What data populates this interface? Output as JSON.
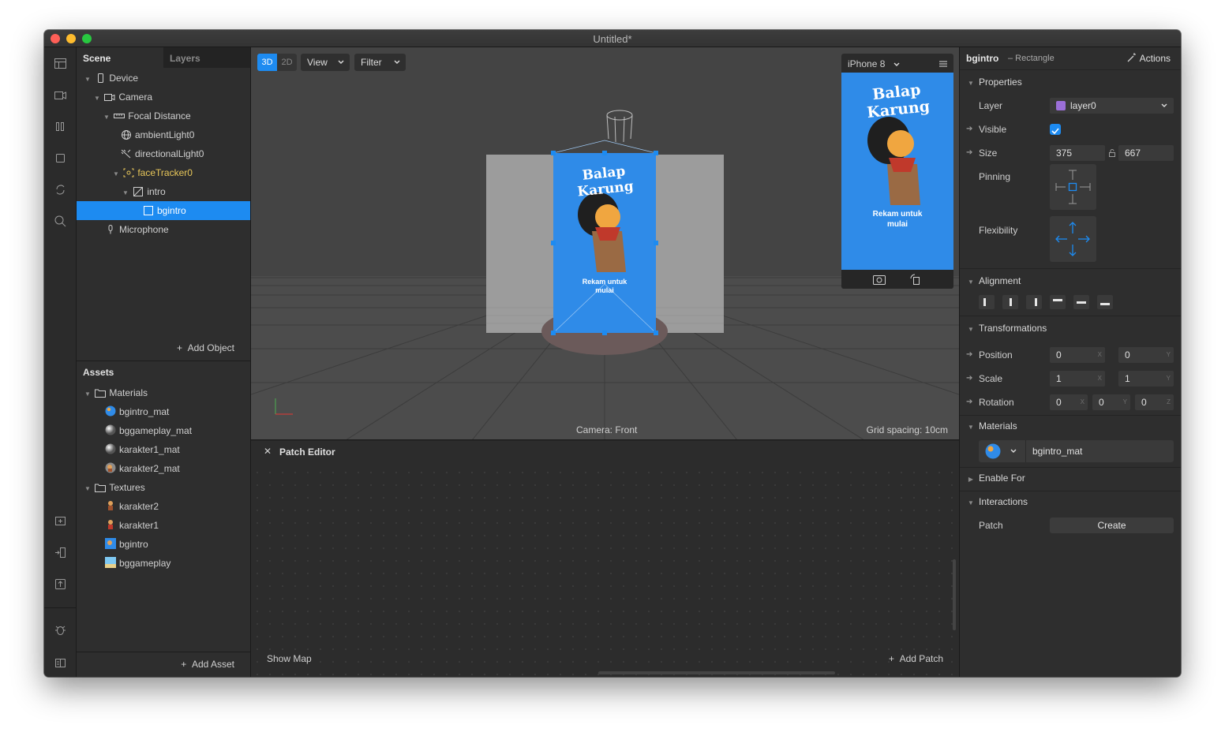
{
  "window": {
    "title": "Untitled*"
  },
  "scene_panel": {
    "tabs": [
      {
        "label": "Scene"
      },
      {
        "label": "Layers"
      }
    ],
    "tree": [
      {
        "label": "Device"
      },
      {
        "label": "Camera"
      },
      {
        "label": "Focal Distance"
      },
      {
        "label": "ambientLight0"
      },
      {
        "label": "directionalLight0"
      },
      {
        "label": "faceTracker0"
      },
      {
        "label": "intro"
      },
      {
        "label": "bgintro"
      },
      {
        "label": "Microphone"
      }
    ],
    "add_object_label": "Add Object",
    "assets_title": "Assets",
    "assets": [
      {
        "label": "Materials"
      },
      {
        "label": "bgintro_mat"
      },
      {
        "label": "bggameplay_mat"
      },
      {
        "label": "karakter1_mat"
      },
      {
        "label": "karakter2_mat"
      },
      {
        "label": "Textures"
      },
      {
        "label": "karakter2"
      },
      {
        "label": "karakter1"
      },
      {
        "label": "bgintro"
      },
      {
        "label": "bggameplay"
      }
    ],
    "add_asset_label": "Add Asset"
  },
  "viewport": {
    "mode_3d": "3D",
    "mode_2d": "2D",
    "view_label": "View",
    "filter_label": "Filter",
    "camera_label": "Camera: Front",
    "grid_label": "Grid spacing: 10cm",
    "canvas_title": "Balap Karung",
    "canvas_caption_1": "Rekam untuk",
    "canvas_caption_2": "mulai"
  },
  "phone_preview": {
    "device": "iPhone 8",
    "title": "Balap Karung",
    "caption_1": "Rekam untuk",
    "caption_2": "mulai"
  },
  "patch_editor": {
    "title": "Patch Editor",
    "show_map": "Show Map",
    "add_patch": "Add Patch"
  },
  "inspector": {
    "object_name": "bgintro",
    "object_type": "– Rectangle",
    "actions_label": "Actions",
    "properties_title": "Properties",
    "layer_label": "Layer",
    "layer_value": "layer0",
    "visible_label": "Visible",
    "visible_checked": true,
    "size_label": "Size",
    "size_w": "375",
    "size_h": "667",
    "pinning_label": "Pinning",
    "flexibility_label": "Flexibility",
    "alignment_title": "Alignment",
    "transformations_title": "Transformations",
    "position_label": "Position",
    "position_x": "0",
    "position_y": "0",
    "scale_label": "Scale",
    "scale_x": "1",
    "scale_y": "1",
    "rotation_label": "Rotation",
    "rotation_x": "0",
    "rotation_y": "0",
    "rotation_z": "0",
    "axis_x": "X",
    "axis_y": "Y",
    "axis_z": "Z",
    "materials_title": "Materials",
    "material_value": "bgintro_mat",
    "enable_for_title": "Enable For",
    "interactions_title": "Interactions",
    "patch_label": "Patch",
    "create_label": "Create"
  },
  "colors": {
    "accent": "#1d8bf1",
    "canvas_blue": "#2f8be8",
    "highlight_yellow": "#e8c75a",
    "layer_swatch": "#9b6fd8"
  }
}
